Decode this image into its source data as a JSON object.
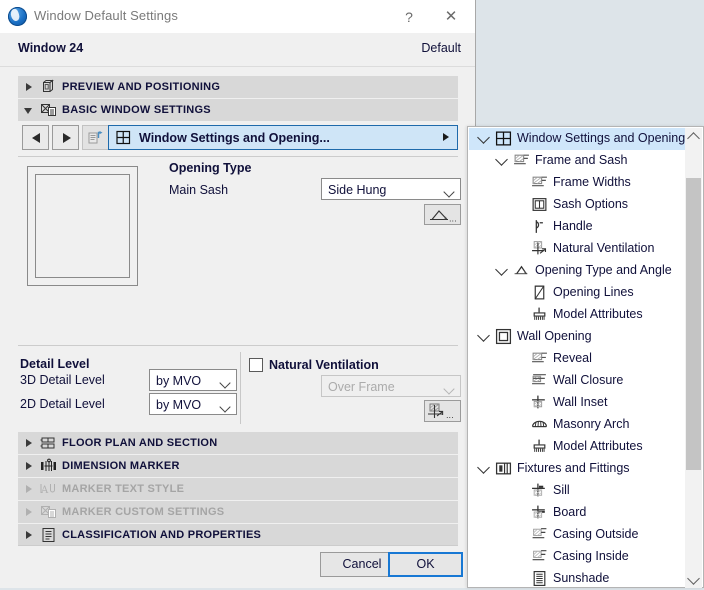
{
  "window": {
    "title": "Window Default Settings",
    "help_label": "?",
    "close_label": "✕",
    "object_name": "Window  24",
    "favorite_label": "Default"
  },
  "sections": [
    {
      "label": "PREVIEW AND POSITIONING",
      "expanded": false,
      "enabled": true,
      "icon": "cube-icon"
    },
    {
      "label": "BASIC WINDOW SETTINGS",
      "expanded": true,
      "enabled": true,
      "icon": "custom-settings-icon"
    },
    {
      "label": "FLOOR PLAN AND SECTION",
      "expanded": false,
      "enabled": true,
      "icon": "floor-plan-icon"
    },
    {
      "label": "DIMENSION MARKER",
      "expanded": false,
      "enabled": true,
      "icon": "dimension-marker-icon"
    },
    {
      "label": "MARKER TEXT STYLE",
      "expanded": false,
      "enabled": false,
      "icon": "text-style-icon"
    },
    {
      "label": "MARKER CUSTOM SETTINGS",
      "expanded": false,
      "enabled": false,
      "icon": "custom-settings-icon"
    },
    {
      "label": "CLASSIFICATION AND PROPERTIES",
      "expanded": false,
      "enabled": true,
      "icon": "list-icon"
    }
  ],
  "toolbar": {
    "back_label": "◀",
    "forward_label": "▶",
    "page_icon": "page-with-arrow-icon",
    "page_selector_value": "Window Settings and Opening...",
    "page_selector_icon": "grid-window-icon"
  },
  "opening": {
    "group_title": "Opening Type",
    "main_sash_label": "Main Sash",
    "main_sash_value": "Side Hung",
    "sash_options": [
      "Side Hung"
    ],
    "angle_button_icon": "opening-angle-icon"
  },
  "detail": {
    "group_title": "Detail Level",
    "rows": [
      {
        "label": "3D Detail Level",
        "value": "by MVO"
      },
      {
        "label": "2D Detail Level",
        "value": "by MVO"
      }
    ],
    "options": [
      "by MVO"
    ]
  },
  "ventilation": {
    "checkbox_label": "Natural Ventilation",
    "checked": false,
    "select_value": "Over Frame",
    "select_enabled": false,
    "options": [
      "Over Frame"
    ],
    "settings_button_icon": "ventilation-icon"
  },
  "footer": {
    "cancel_label": "Cancel",
    "ok_label": "OK"
  },
  "tree": {
    "items": [
      {
        "label": "Window Settings and Opening",
        "depth": 0,
        "toggle": "expanded",
        "icon": "grid-window-icon",
        "selected": true
      },
      {
        "label": "Frame and Sash",
        "depth": 1,
        "toggle": "expanded",
        "icon": "frame-sash-icon",
        "selected": false
      },
      {
        "label": "Frame Widths",
        "depth": 2,
        "toggle": "none",
        "icon": "frame-width-icon",
        "selected": false
      },
      {
        "label": "Sash Options",
        "depth": 2,
        "toggle": "none",
        "icon": "sash-options-icon",
        "selected": false
      },
      {
        "label": "Handle",
        "depth": 2,
        "toggle": "none",
        "icon": "handle-icon",
        "selected": false
      },
      {
        "label": "Natural Ventilation",
        "depth": 2,
        "toggle": "none",
        "icon": "ventilation-icon",
        "selected": false
      },
      {
        "label": "Opening Type and Angle",
        "depth": 1,
        "toggle": "expanded",
        "icon": "opening-angle-icon",
        "selected": false
      },
      {
        "label": "Opening Lines",
        "depth": 2,
        "toggle": "none",
        "icon": "opening-lines-icon",
        "selected": false
      },
      {
        "label": "Model Attributes",
        "depth": 2,
        "toggle": "none",
        "icon": "brush-icon",
        "selected": false
      },
      {
        "label": "Wall Opening",
        "depth": 0,
        "toggle": "expanded",
        "icon": "wall-opening-icon",
        "selected": false
      },
      {
        "label": "Reveal",
        "depth": 2,
        "toggle": "none",
        "icon": "reveal-icon",
        "selected": false
      },
      {
        "label": "Wall Closure",
        "depth": 2,
        "toggle": "none",
        "icon": "wall-closure-icon",
        "selected": false
      },
      {
        "label": "Wall Inset",
        "depth": 2,
        "toggle": "none",
        "icon": "wall-inset-icon",
        "selected": false
      },
      {
        "label": "Masonry Arch",
        "depth": 2,
        "toggle": "none",
        "icon": "masonry-arch-icon",
        "selected": false
      },
      {
        "label": "Model Attributes",
        "depth": 2,
        "toggle": "none",
        "icon": "brush-icon",
        "selected": false
      },
      {
        "label": "Fixtures and Fittings",
        "depth": 0,
        "toggle": "expanded",
        "icon": "fixtures-icon",
        "selected": false
      },
      {
        "label": "Sill",
        "depth": 2,
        "toggle": "none",
        "icon": "sill-icon",
        "selected": false
      },
      {
        "label": "Board",
        "depth": 2,
        "toggle": "none",
        "icon": "board-icon",
        "selected": false
      },
      {
        "label": "Casing Outside",
        "depth": 2,
        "toggle": "none",
        "icon": "casing-outside-icon",
        "selected": false
      },
      {
        "label": "Casing Inside",
        "depth": 2,
        "toggle": "none",
        "icon": "casing-inside-icon",
        "selected": false
      },
      {
        "label": "Sunshade",
        "depth": 2,
        "toggle": "none",
        "icon": "sunshade-icon",
        "selected": false
      }
    ],
    "scroll_up_icon": "chevron-up-icon",
    "scroll_down_icon": "chevron-down-icon"
  },
  "colors": {
    "desktop": "#dde4e9",
    "dialog_bg": "#f0f0f0",
    "section_bar": "#d8d8d8",
    "accent_blue": "#1878d4",
    "selection": "#cfe6fa"
  }
}
